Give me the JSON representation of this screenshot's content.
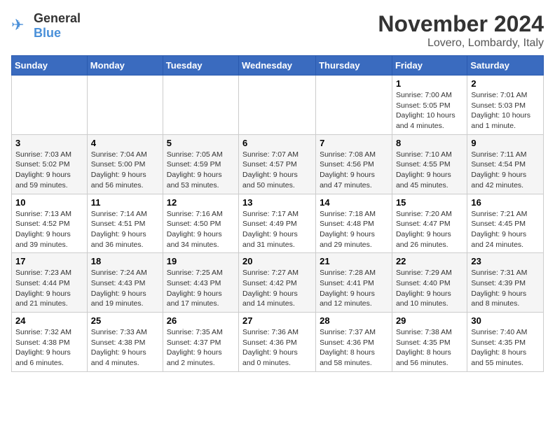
{
  "logo": {
    "text_general": "General",
    "text_blue": "Blue"
  },
  "header": {
    "month_title": "November 2024",
    "location": "Lovero, Lombardy, Italy"
  },
  "weekdays": [
    "Sunday",
    "Monday",
    "Tuesday",
    "Wednesday",
    "Thursday",
    "Friday",
    "Saturday"
  ],
  "weeks": [
    [
      {
        "day": "",
        "info": ""
      },
      {
        "day": "",
        "info": ""
      },
      {
        "day": "",
        "info": ""
      },
      {
        "day": "",
        "info": ""
      },
      {
        "day": "",
        "info": ""
      },
      {
        "day": "1",
        "info": "Sunrise: 7:00 AM\nSunset: 5:05 PM\nDaylight: 10 hours\nand 4 minutes."
      },
      {
        "day": "2",
        "info": "Sunrise: 7:01 AM\nSunset: 5:03 PM\nDaylight: 10 hours\nand 1 minute."
      }
    ],
    [
      {
        "day": "3",
        "info": "Sunrise: 7:03 AM\nSunset: 5:02 PM\nDaylight: 9 hours\nand 59 minutes."
      },
      {
        "day": "4",
        "info": "Sunrise: 7:04 AM\nSunset: 5:00 PM\nDaylight: 9 hours\nand 56 minutes."
      },
      {
        "day": "5",
        "info": "Sunrise: 7:05 AM\nSunset: 4:59 PM\nDaylight: 9 hours\nand 53 minutes."
      },
      {
        "day": "6",
        "info": "Sunrise: 7:07 AM\nSunset: 4:57 PM\nDaylight: 9 hours\nand 50 minutes."
      },
      {
        "day": "7",
        "info": "Sunrise: 7:08 AM\nSunset: 4:56 PM\nDaylight: 9 hours\nand 47 minutes."
      },
      {
        "day": "8",
        "info": "Sunrise: 7:10 AM\nSunset: 4:55 PM\nDaylight: 9 hours\nand 45 minutes."
      },
      {
        "day": "9",
        "info": "Sunrise: 7:11 AM\nSunset: 4:54 PM\nDaylight: 9 hours\nand 42 minutes."
      }
    ],
    [
      {
        "day": "10",
        "info": "Sunrise: 7:13 AM\nSunset: 4:52 PM\nDaylight: 9 hours\nand 39 minutes."
      },
      {
        "day": "11",
        "info": "Sunrise: 7:14 AM\nSunset: 4:51 PM\nDaylight: 9 hours\nand 36 minutes."
      },
      {
        "day": "12",
        "info": "Sunrise: 7:16 AM\nSunset: 4:50 PM\nDaylight: 9 hours\nand 34 minutes."
      },
      {
        "day": "13",
        "info": "Sunrise: 7:17 AM\nSunset: 4:49 PM\nDaylight: 9 hours\nand 31 minutes."
      },
      {
        "day": "14",
        "info": "Sunrise: 7:18 AM\nSunset: 4:48 PM\nDaylight: 9 hours\nand 29 minutes."
      },
      {
        "day": "15",
        "info": "Sunrise: 7:20 AM\nSunset: 4:47 PM\nDaylight: 9 hours\nand 26 minutes."
      },
      {
        "day": "16",
        "info": "Sunrise: 7:21 AM\nSunset: 4:45 PM\nDaylight: 9 hours\nand 24 minutes."
      }
    ],
    [
      {
        "day": "17",
        "info": "Sunrise: 7:23 AM\nSunset: 4:44 PM\nDaylight: 9 hours\nand 21 minutes."
      },
      {
        "day": "18",
        "info": "Sunrise: 7:24 AM\nSunset: 4:43 PM\nDaylight: 9 hours\nand 19 minutes."
      },
      {
        "day": "19",
        "info": "Sunrise: 7:25 AM\nSunset: 4:43 PM\nDaylight: 9 hours\nand 17 minutes."
      },
      {
        "day": "20",
        "info": "Sunrise: 7:27 AM\nSunset: 4:42 PM\nDaylight: 9 hours\nand 14 minutes."
      },
      {
        "day": "21",
        "info": "Sunrise: 7:28 AM\nSunset: 4:41 PM\nDaylight: 9 hours\nand 12 minutes."
      },
      {
        "day": "22",
        "info": "Sunrise: 7:29 AM\nSunset: 4:40 PM\nDaylight: 9 hours\nand 10 minutes."
      },
      {
        "day": "23",
        "info": "Sunrise: 7:31 AM\nSunset: 4:39 PM\nDaylight: 9 hours\nand 8 minutes."
      }
    ],
    [
      {
        "day": "24",
        "info": "Sunrise: 7:32 AM\nSunset: 4:38 PM\nDaylight: 9 hours\nand 6 minutes."
      },
      {
        "day": "25",
        "info": "Sunrise: 7:33 AM\nSunset: 4:38 PM\nDaylight: 9 hours\nand 4 minutes."
      },
      {
        "day": "26",
        "info": "Sunrise: 7:35 AM\nSunset: 4:37 PM\nDaylight: 9 hours\nand 2 minutes."
      },
      {
        "day": "27",
        "info": "Sunrise: 7:36 AM\nSunset: 4:36 PM\nDaylight: 9 hours\nand 0 minutes."
      },
      {
        "day": "28",
        "info": "Sunrise: 7:37 AM\nSunset: 4:36 PM\nDaylight: 8 hours\nand 58 minutes."
      },
      {
        "day": "29",
        "info": "Sunrise: 7:38 AM\nSunset: 4:35 PM\nDaylight: 8 hours\nand 56 minutes."
      },
      {
        "day": "30",
        "info": "Sunrise: 7:40 AM\nSunset: 4:35 PM\nDaylight: 8 hours\nand 55 minutes."
      }
    ]
  ]
}
